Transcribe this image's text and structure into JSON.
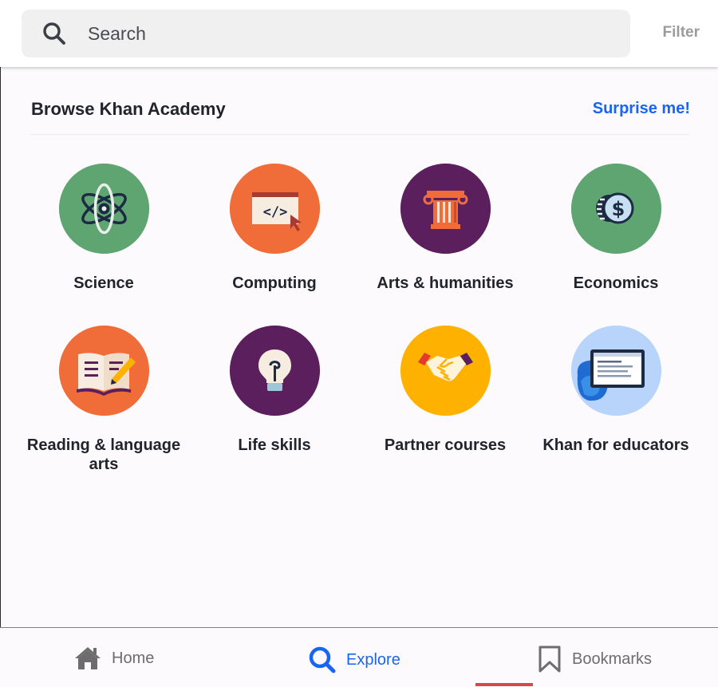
{
  "search": {
    "placeholder": "Search",
    "filter_label": "Filter"
  },
  "browse": {
    "title": "Browse Khan Academy",
    "surprise_label": "Surprise me!",
    "subjects": [
      {
        "label": "Science",
        "icon": "atom-icon",
        "color": "#5fa572"
      },
      {
        "label": "Computing",
        "icon": "code-window-icon",
        "color": "#f06d39"
      },
      {
        "label": "Arts & humanities",
        "icon": "column-icon",
        "color": "#5c1f5e"
      },
      {
        "label": "Economics",
        "icon": "dollar-coin-icon",
        "color": "#5fa572"
      },
      {
        "label": "Reading & language arts",
        "icon": "book-pencil-icon",
        "color": "#f06d39"
      },
      {
        "label": "Life skills",
        "icon": "lightbulb-icon",
        "color": "#5c1f5e"
      },
      {
        "label": "Partner courses",
        "icon": "handshake-icon",
        "color": "#ffb100"
      },
      {
        "label": "Khan for educators",
        "icon": "tablet-icon",
        "color": "#b9d4fa"
      }
    ]
  },
  "nav": {
    "home_label": "Home",
    "explore_label": "Explore",
    "bookmarks_label": "Bookmarks",
    "active": "explore"
  },
  "colors": {
    "accent": "#1865f2",
    "muted": "#6d6d6d"
  }
}
